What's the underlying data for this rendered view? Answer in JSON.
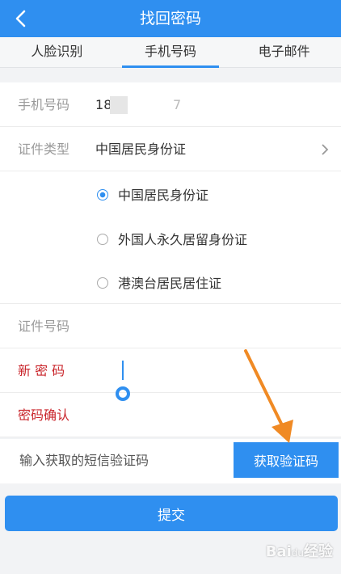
{
  "header": {
    "title": "找回密码",
    "back_icon": "chevron-left-icon"
  },
  "tabs": [
    {
      "label": "人脸识别",
      "active": false
    },
    {
      "label": "手机号码",
      "active": true
    },
    {
      "label": "电子邮件",
      "active": false
    }
  ],
  "form": {
    "phone": {
      "label": "手机号码",
      "value_start": "1",
      "value_mid": "8",
      "value_end": "7"
    },
    "id_type": {
      "label": "证件类型",
      "value": "中国居民身份证",
      "chevron_icon": "chevron-right-icon"
    },
    "id_options": [
      {
        "label": "中国居民身份证",
        "selected": true
      },
      {
        "label": "外国人永久居留身份证",
        "selected": false
      },
      {
        "label": "港澳台居民居住证",
        "selected": false
      }
    ],
    "id_number": {
      "label": "证件号码"
    },
    "new_password": {
      "label": "新 密 码"
    },
    "confirm_password": {
      "label": "密码确认"
    }
  },
  "sms": {
    "placeholder": "输入获取的短信验证码",
    "button_label": "获取验证码"
  },
  "submit_label": "提交",
  "colors": {
    "primary": "#2f8ff0",
    "required_label": "#c9252b",
    "annotation_arrow": "#f08a24"
  },
  "watermark": {
    "text": "Bai",
    "paw": "du",
    "suffix": "经验"
  }
}
